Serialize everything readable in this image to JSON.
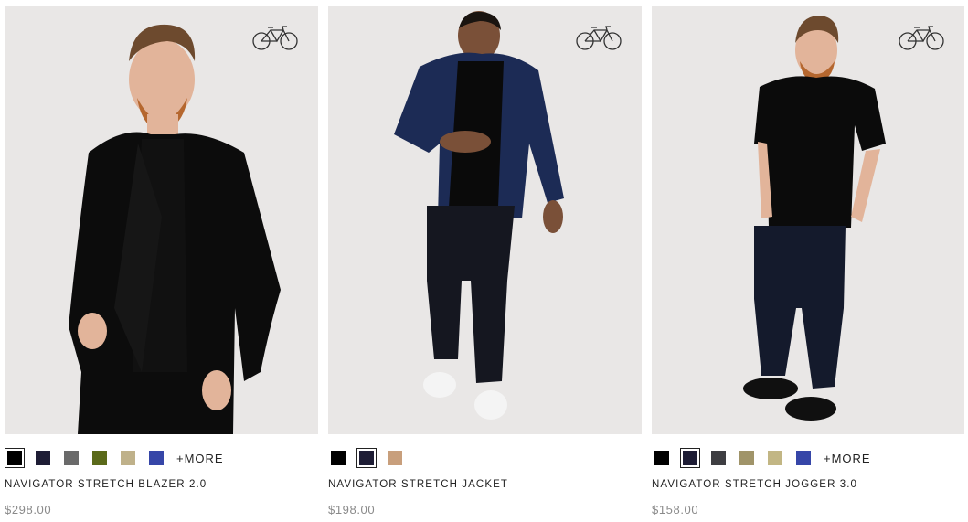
{
  "products": [
    {
      "name": "NAVIGATOR STRETCH BLAZER 2.0",
      "price": "$298.00",
      "more_label": "+MORE",
      "badge_icon": "bicycle-icon",
      "swatches": [
        "#000000",
        "#1e1d35",
        "#6a6a6a",
        "#5b6a1a",
        "#bfb18a",
        "#3646a8"
      ],
      "selected_swatch": 0,
      "figure": {
        "top": "#0c0c0c",
        "shirt": "#111111",
        "pants": "#0c0c0c",
        "style": "blazer"
      }
    },
    {
      "name": "NAVIGATOR STRETCH JACKET",
      "price": "$198.00",
      "more_label": "",
      "badge_icon": "bicycle-icon",
      "swatches": [
        "#000000",
        "#1e1d35",
        "#c89f7c"
      ],
      "selected_swatch": 1,
      "figure": {
        "top": "#1c2b55",
        "shirt": "#0a0a0a",
        "pants": "#151720",
        "style": "jacket"
      }
    },
    {
      "name": "NAVIGATOR STRETCH JOGGER 3.0",
      "price": "$158.00",
      "more_label": "+MORE",
      "badge_icon": "bicycle-icon",
      "swatches": [
        "#000000",
        "#1e1d35",
        "#3e3e42",
        "#a09469",
        "#c2b684",
        "#3646a8"
      ],
      "selected_swatch": 1,
      "figure": {
        "top": "#0b0b0b",
        "shirt": "#0b0b0b",
        "pants": "#141a2c",
        "style": "tee"
      }
    }
  ]
}
